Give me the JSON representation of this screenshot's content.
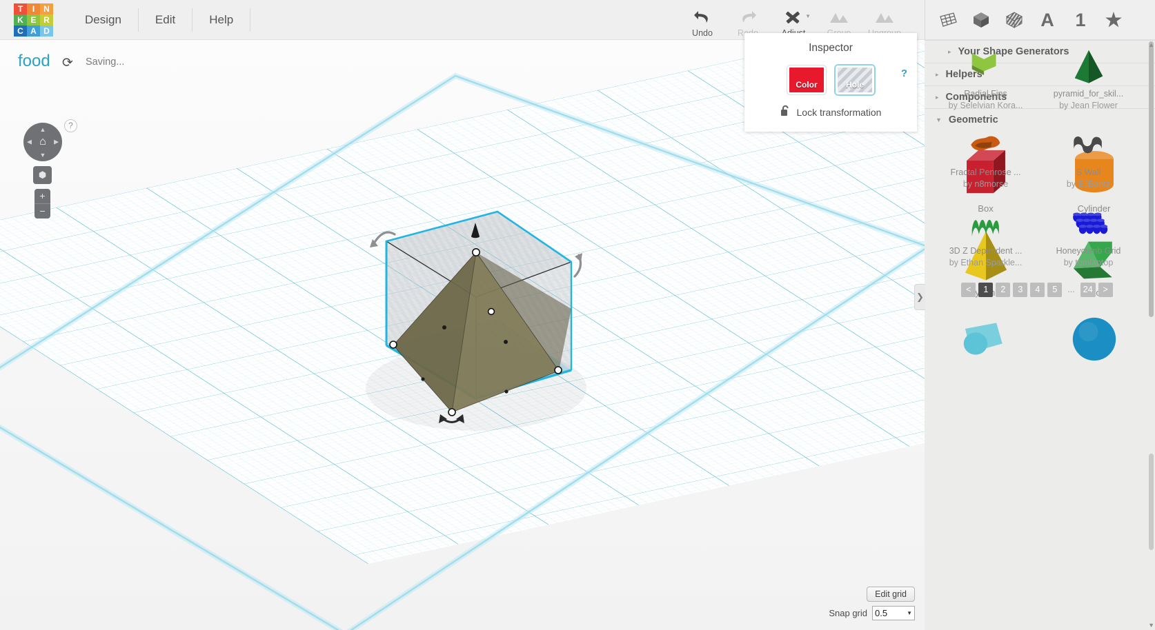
{
  "app": {
    "logo_letters": [
      "T",
      "I",
      "N",
      "K",
      "E",
      "R",
      "C",
      "A",
      "D"
    ],
    "logo_colors": [
      "#ef5138",
      "#f0883a",
      "#f5a03c",
      "#4fb152",
      "#8ec63f",
      "#c3ce35",
      "#1e6fb8",
      "#3fa0d8",
      "#79c5ec"
    ]
  },
  "menu": {
    "items": [
      "Design",
      "Edit",
      "Help"
    ]
  },
  "toolbar": {
    "tools": [
      {
        "label": "Undo",
        "icon": "undo-icon",
        "disabled": false,
        "caret": false
      },
      {
        "label": "Redo",
        "icon": "redo-icon",
        "disabled": true,
        "caret": false
      },
      {
        "label": "Adjust",
        "icon": "adjust-icon",
        "disabled": false,
        "caret": true
      },
      {
        "label": "Group",
        "icon": "group-icon",
        "disabled": true,
        "caret": false
      },
      {
        "label": "Ungroup",
        "icon": "ungroup-icon",
        "disabled": true,
        "caret": false
      }
    ],
    "right_icons": [
      {
        "name": "workplane-icon",
        "glyph": ""
      },
      {
        "name": "solid-cube-icon",
        "glyph": ""
      },
      {
        "name": "striped-cube-icon",
        "glyph": ""
      },
      {
        "name": "letters-icon",
        "glyph": "A"
      },
      {
        "name": "numbers-icon",
        "glyph": "1"
      },
      {
        "name": "favorites-star-icon",
        "glyph": "★"
      }
    ]
  },
  "canvas": {
    "project_title": "food",
    "save_status": "Saving...",
    "help_badge": "?",
    "refresh_icon": "⟳",
    "nav": {
      "home_icon": "⌂",
      "arrow_up": "▲",
      "arrow_down": "▼",
      "arrow_left": "◀",
      "arrow_right": "▶",
      "fit_icon": "⬢",
      "zoom_in": "+",
      "zoom_out": "−"
    },
    "panel_toggle_icon": "❯",
    "edit_grid_label": "Edit grid",
    "snap_grid_label": "Snap grid",
    "snap_grid_value": "0.5",
    "snap_caret": "▼"
  },
  "inspector": {
    "title": "Inspector",
    "color_label": "Color",
    "hole_label": "Hole",
    "selected_swatch": "Hole",
    "color_hex": "#e8192c",
    "lock_label": "Lock transformation",
    "lock_icon": "🔓",
    "help_link": "?"
  },
  "sidebar": {
    "gallery": [
      {
        "name": "Radial Fins",
        "author": "by Selelvian Kora...",
        "color": "#8ec63f",
        "shape": "fins"
      },
      {
        "name": "pyramid_for_skil...",
        "author": "by Jean Flower",
        "color": "#1d7a34",
        "shape": "pyramid"
      },
      {
        "name": "Fractal Penrose ...",
        "author": "by n8morse",
        "color": "#c85a14",
        "shape": "fractal"
      },
      {
        "name": "S Wall",
        "author": "by EJBantz",
        "color": "#4a4a4a",
        "shape": "swall"
      },
      {
        "name": "3D Z Dependent ...",
        "author": "by Ethan Sparkle...",
        "color": "#2a9c3f",
        "shape": "wave"
      },
      {
        "name": "Honeycomb Grid",
        "author": "by tomlaptop",
        "color": "#1919d8",
        "shape": "honeycomb"
      }
    ],
    "pagination": {
      "prev": "<",
      "pages": [
        "1",
        "2",
        "3",
        "4",
        "5"
      ],
      "ellipsis": "...",
      "last": "24",
      "next": ">",
      "active": "1"
    },
    "sections": [
      {
        "label": "Your Shape Generators",
        "expanded": false,
        "indent": true
      },
      {
        "label": "Helpers",
        "expanded": false,
        "indent": false
      },
      {
        "label": "Components",
        "expanded": false,
        "indent": false
      },
      {
        "label": "Geometric",
        "expanded": true,
        "indent": false
      }
    ],
    "geometric_shapes": [
      {
        "name": "Box",
        "color": "#c8202e",
        "shape": "box"
      },
      {
        "name": "Cylinder",
        "color": "#e8861e",
        "shape": "cylinder"
      },
      {
        "name": "Pyramid",
        "color": "#e8c71e",
        "shape": "pyramid"
      },
      {
        "name": "Roof",
        "color": "#34a84a",
        "shape": "roof"
      },
      {
        "name": "",
        "color": "#5cc4d6",
        "shape": "halfcyl"
      },
      {
        "name": "",
        "color": "#1b8fc4",
        "shape": "sphere"
      }
    ],
    "expand_tri": "▼",
    "collapse_tri": "▸"
  }
}
